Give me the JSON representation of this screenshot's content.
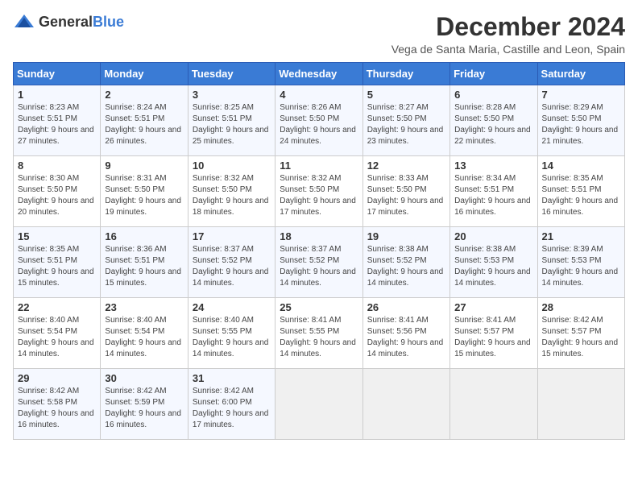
{
  "logo": {
    "text_general": "General",
    "text_blue": "Blue"
  },
  "header": {
    "month": "December 2024",
    "location": "Vega de Santa Maria, Castille and Leon, Spain"
  },
  "weekdays": [
    "Sunday",
    "Monday",
    "Tuesday",
    "Wednesday",
    "Thursday",
    "Friday",
    "Saturday"
  ],
  "weeks": [
    [
      {
        "day": "1",
        "sunrise": "8:23 AM",
        "sunset": "5:51 PM",
        "daylight": "9 hours and 27 minutes."
      },
      {
        "day": "2",
        "sunrise": "8:24 AM",
        "sunset": "5:51 PM",
        "daylight": "9 hours and 26 minutes."
      },
      {
        "day": "3",
        "sunrise": "8:25 AM",
        "sunset": "5:51 PM",
        "daylight": "9 hours and 25 minutes."
      },
      {
        "day": "4",
        "sunrise": "8:26 AM",
        "sunset": "5:50 PM",
        "daylight": "9 hours and 24 minutes."
      },
      {
        "day": "5",
        "sunrise": "8:27 AM",
        "sunset": "5:50 PM",
        "daylight": "9 hours and 23 minutes."
      },
      {
        "day": "6",
        "sunrise": "8:28 AM",
        "sunset": "5:50 PM",
        "daylight": "9 hours and 22 minutes."
      },
      {
        "day": "7",
        "sunrise": "8:29 AM",
        "sunset": "5:50 PM",
        "daylight": "9 hours and 21 minutes."
      }
    ],
    [
      {
        "day": "8",
        "sunrise": "8:30 AM",
        "sunset": "5:50 PM",
        "daylight": "9 hours and 20 minutes."
      },
      {
        "day": "9",
        "sunrise": "8:31 AM",
        "sunset": "5:50 PM",
        "daylight": "9 hours and 19 minutes."
      },
      {
        "day": "10",
        "sunrise": "8:32 AM",
        "sunset": "5:50 PM",
        "daylight": "9 hours and 18 minutes."
      },
      {
        "day": "11",
        "sunrise": "8:32 AM",
        "sunset": "5:50 PM",
        "daylight": "9 hours and 17 minutes."
      },
      {
        "day": "12",
        "sunrise": "8:33 AM",
        "sunset": "5:50 PM",
        "daylight": "9 hours and 17 minutes."
      },
      {
        "day": "13",
        "sunrise": "8:34 AM",
        "sunset": "5:51 PM",
        "daylight": "9 hours and 16 minutes."
      },
      {
        "day": "14",
        "sunrise": "8:35 AM",
        "sunset": "5:51 PM",
        "daylight": "9 hours and 16 minutes."
      }
    ],
    [
      {
        "day": "15",
        "sunrise": "8:35 AM",
        "sunset": "5:51 PM",
        "daylight": "9 hours and 15 minutes."
      },
      {
        "day": "16",
        "sunrise": "8:36 AM",
        "sunset": "5:51 PM",
        "daylight": "9 hours and 15 minutes."
      },
      {
        "day": "17",
        "sunrise": "8:37 AM",
        "sunset": "5:52 PM",
        "daylight": "9 hours and 14 minutes."
      },
      {
        "day": "18",
        "sunrise": "8:37 AM",
        "sunset": "5:52 PM",
        "daylight": "9 hours and 14 minutes."
      },
      {
        "day": "19",
        "sunrise": "8:38 AM",
        "sunset": "5:52 PM",
        "daylight": "9 hours and 14 minutes."
      },
      {
        "day": "20",
        "sunrise": "8:38 AM",
        "sunset": "5:53 PM",
        "daylight": "9 hours and 14 minutes."
      },
      {
        "day": "21",
        "sunrise": "8:39 AM",
        "sunset": "5:53 PM",
        "daylight": "9 hours and 14 minutes."
      }
    ],
    [
      {
        "day": "22",
        "sunrise": "8:40 AM",
        "sunset": "5:54 PM",
        "daylight": "9 hours and 14 minutes."
      },
      {
        "day": "23",
        "sunrise": "8:40 AM",
        "sunset": "5:54 PM",
        "daylight": "9 hours and 14 minutes."
      },
      {
        "day": "24",
        "sunrise": "8:40 AM",
        "sunset": "5:55 PM",
        "daylight": "9 hours and 14 minutes."
      },
      {
        "day": "25",
        "sunrise": "8:41 AM",
        "sunset": "5:55 PM",
        "daylight": "9 hours and 14 minutes."
      },
      {
        "day": "26",
        "sunrise": "8:41 AM",
        "sunset": "5:56 PM",
        "daylight": "9 hours and 14 minutes."
      },
      {
        "day": "27",
        "sunrise": "8:41 AM",
        "sunset": "5:57 PM",
        "daylight": "9 hours and 15 minutes."
      },
      {
        "day": "28",
        "sunrise": "8:42 AM",
        "sunset": "5:57 PM",
        "daylight": "9 hours and 15 minutes."
      }
    ],
    [
      {
        "day": "29",
        "sunrise": "8:42 AM",
        "sunset": "5:58 PM",
        "daylight": "9 hours and 16 minutes."
      },
      {
        "day": "30",
        "sunrise": "8:42 AM",
        "sunset": "5:59 PM",
        "daylight": "9 hours and 16 minutes."
      },
      {
        "day": "31",
        "sunrise": "8:42 AM",
        "sunset": "6:00 PM",
        "daylight": "9 hours and 17 minutes."
      },
      null,
      null,
      null,
      null
    ]
  ],
  "labels": {
    "sunrise": "Sunrise:",
    "sunset": "Sunset:",
    "daylight": "Daylight:"
  }
}
